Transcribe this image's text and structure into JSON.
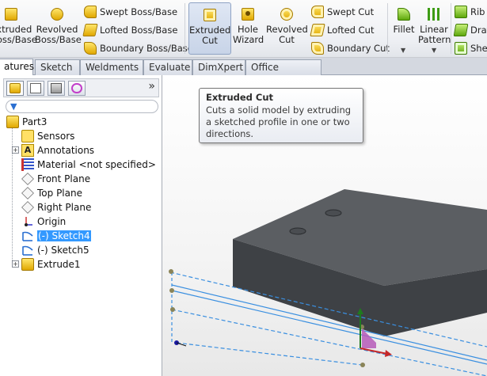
{
  "ribbon": {
    "extruded_boss_label": "Extruded\nBoss/Base",
    "revolved_boss_label": "Revolved\nBoss/Base",
    "swept_boss_label": "Swept Boss/Base",
    "lofted_boss_label": "Lofted Boss/Base",
    "boundary_boss_label": "Boundary Boss/Base",
    "extruded_cut_label": "Extruded\nCut",
    "hole_wizard_label": "Hole\nWizard",
    "revolved_cut_label": "Revolved\nCut",
    "swept_cut_label": "Swept Cut",
    "lofted_cut_label": "Lofted Cut",
    "boundary_cut_label": "Boundary Cut",
    "fillet_label": "Fillet",
    "linear_pattern_label": "Linear\nPattern",
    "rib_label": "Rib",
    "draft_label": "Draf",
    "shell_label": "She"
  },
  "tabs": [
    "atures",
    "Sketch",
    "Weldments",
    "Evaluate",
    "DimXpert",
    "Office Products"
  ],
  "tooltip": {
    "title": "Extruded Cut",
    "body": "Cuts a solid model by extruding a sketched profile in one or two directions."
  },
  "tree": {
    "root": "Part3",
    "items": [
      {
        "label": "Sensors",
        "icon": "sensors-icon"
      },
      {
        "label": "Annotations",
        "icon": "annotations-icon",
        "expandable": true
      },
      {
        "label": "Material <not specified>",
        "icon": "material-icon"
      },
      {
        "label": "Front Plane",
        "icon": "plane-icon"
      },
      {
        "label": "Top Plane",
        "icon": "plane-icon"
      },
      {
        "label": "Right Plane",
        "icon": "plane-icon"
      },
      {
        "label": "Origin",
        "icon": "origin-icon"
      },
      {
        "label": "(-) Sketch4",
        "icon": "sketch-icon",
        "selected": true
      },
      {
        "label": "(-) Sketch5",
        "icon": "sketch-icon"
      },
      {
        "label": "Extrude1",
        "icon": "extrude-icon",
        "expandable": true
      }
    ]
  },
  "panel": {
    "chevron": "»"
  },
  "colors": {
    "selection": "#3399ff",
    "sketch_line": "#3a8fe0",
    "block_top": "#5b5e62",
    "block_front": "#3e4145"
  }
}
